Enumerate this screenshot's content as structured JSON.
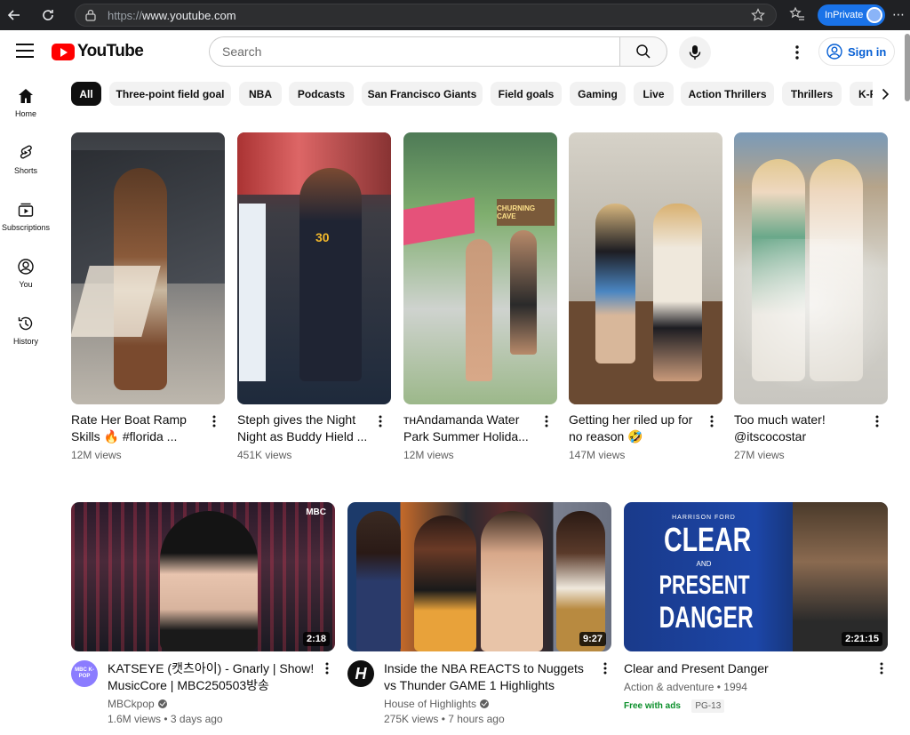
{
  "browser": {
    "url_prefix": "https://",
    "url_host": "www.youtube.com",
    "inprivate_label": "InPrivate"
  },
  "header": {
    "logo_text": "YouTube",
    "search_placeholder": "Search",
    "signin_label": "Sign in"
  },
  "sidebar": {
    "items": [
      {
        "label": "Home",
        "icon": "home-icon"
      },
      {
        "label": "Shorts",
        "icon": "shorts-icon"
      },
      {
        "label": "Subscriptions",
        "icon": "subscriptions-icon"
      },
      {
        "label": "You",
        "icon": "you-icon"
      },
      {
        "label": "History",
        "icon": "history-icon"
      }
    ]
  },
  "chips": [
    "All",
    "Three-point field goal",
    "NBA",
    "Podcasts",
    "San Francisco Giants",
    "Field goals",
    "Gaming",
    "Live",
    "Action Thrillers",
    "Thrillers",
    "K-P"
  ],
  "shorts": [
    {
      "title": "Rate Her Boat Ramp Skills 🔥 #florida ...",
      "views": "12M views"
    },
    {
      "title": "Steph gives the Night Night as Buddy Hield ...",
      "views": "451K views"
    },
    {
      "title": "ᴛʜAndamanda Water Park Summer Holida...",
      "views": "12M views"
    },
    {
      "title": "Getting her riled up for no reason 🤣",
      "views": "147M views"
    },
    {
      "title": "Too much water! @itscocostar",
      "views": "27M views"
    }
  ],
  "videos": [
    {
      "title": "KATSEYE (캣츠아이) - Gnarly | Show! MusicCore | MBC250503방송",
      "channel": "MBCkpop",
      "stats": "1.6M views • 3 days ago",
      "duration": "2:18",
      "avatar_text": "MBC K-POP",
      "thumb_caption": "MBC"
    },
    {
      "title": "Inside the NBA REACTS to Nuggets vs Thunder GAME 1 Highlights",
      "channel": "House of Highlights",
      "stats": "275K views • 7 hours ago",
      "duration": "9:27",
      "avatar_text": "H"
    },
    {
      "title": "Clear and Present Danger",
      "channel": "Action & adventure • 1994",
      "free_label": "Free with ads",
      "rating": "PG-13",
      "duration": "2:21:15",
      "poster_top": "HARRISON FORD",
      "poster_line1": "CLEAR",
      "poster_line2": "AND",
      "poster_line3": "PRESENT",
      "poster_line4": "DANGER"
    }
  ],
  "colors": {
    "brand_red": "#ff0000",
    "link_blue": "#065fd4",
    "free_green": "#0a8f2a"
  }
}
